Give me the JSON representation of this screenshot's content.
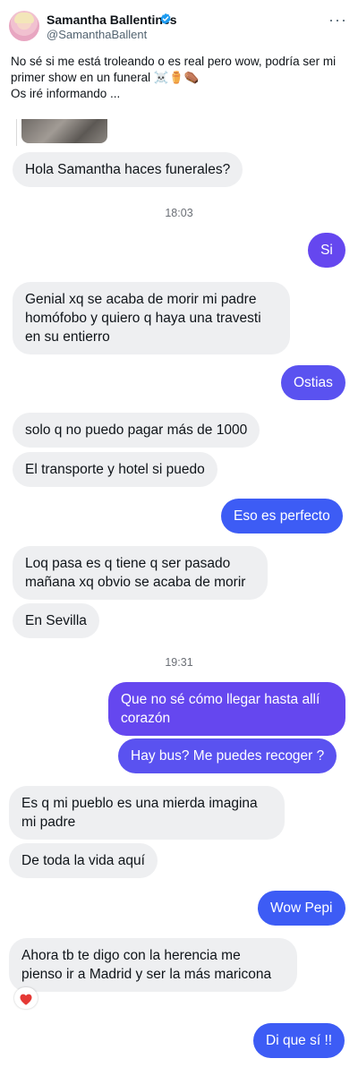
{
  "tweet": {
    "author_name": "Samantha Ballentines",
    "handle": "@SamanthaBallent",
    "text_lines": [
      "No sé si me está troleando o es real pero wow, podría ser mi",
      "primer show en un funeral ☠️⚱️⚰️",
      "Os iré informando ..."
    ]
  },
  "chat": {
    "timestamps": [
      "18:03",
      "19:31"
    ],
    "messages": [
      {
        "from": "them",
        "text": "Hola Samantha haces funerales?"
      },
      {
        "from": "me",
        "text": "Si"
      },
      {
        "from": "them",
        "lines": [
          "Genial xq se acaba de morir mi padre",
          "homófobo y quiero q haya una travesti",
          "en su entierro"
        ]
      },
      {
        "from": "me",
        "text": "Ostias"
      },
      {
        "from": "them",
        "text": "solo q no puedo pagar más de 1000"
      },
      {
        "from": "them",
        "text": "El transporte y hotel si puedo"
      },
      {
        "from": "me",
        "text": "Eso es perfecto"
      },
      {
        "from": "them",
        "lines": [
          "Loq pasa es q tiene q ser pasado",
          "mañana xq obvio se acaba de morir"
        ]
      },
      {
        "from": "them",
        "text": "En Sevilla"
      },
      {
        "from": "me",
        "lines": [
          "Que no sé cómo llegar hasta allí",
          "corazón"
        ]
      },
      {
        "from": "me",
        "text": "Hay bus? Me puedes recoger ?"
      },
      {
        "from": "them",
        "lines": [
          "Es q mi pueblo es una mierda imagina",
          "mi padre"
        ]
      },
      {
        "from": "them",
        "text": "De toda la vida aquí"
      },
      {
        "from": "me",
        "text": "Wow Pepi"
      },
      {
        "from": "them",
        "lines": [
          "Ahora tb te digo con la herencia me",
          "pienso ir a Madrid y ser la más maricona"
        ]
      },
      {
        "from": "me",
        "text": "Di que sí !!"
      }
    ],
    "reaction": "❤️"
  },
  "colors": {
    "outgoing": "#3d5cf5",
    "incoming": "#eeeff1",
    "verified": "#1d9bf0"
  }
}
